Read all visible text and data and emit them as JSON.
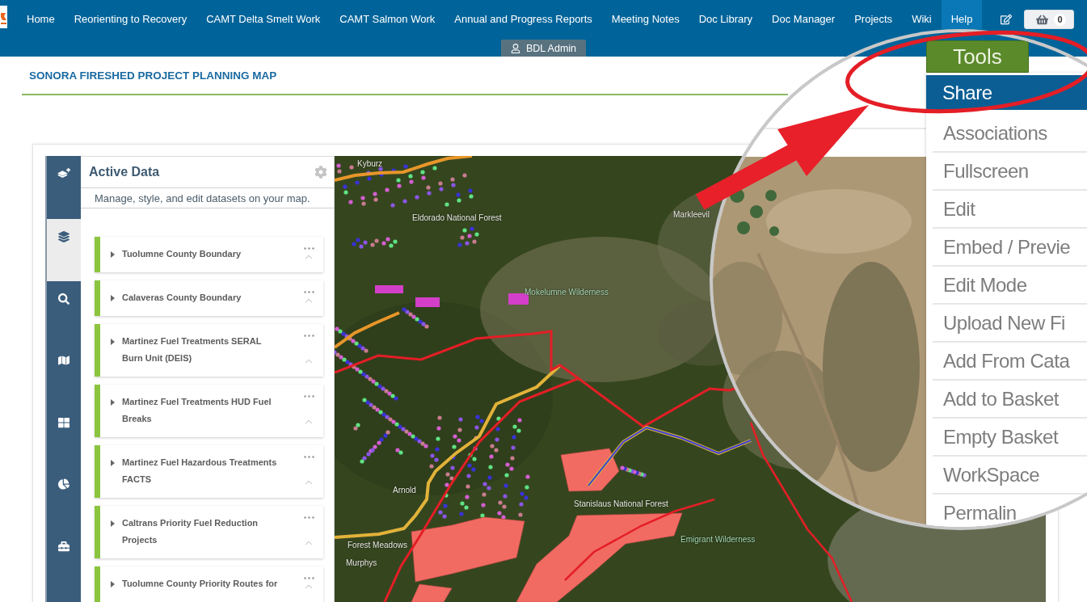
{
  "nav": {
    "items": [
      {
        "label": "Home",
        "selected": false
      },
      {
        "label": "Reorienting to Recovery",
        "selected": false
      },
      {
        "label": "CAMT Delta Smelt Work",
        "selected": false
      },
      {
        "label": "CAMT Salmon Work",
        "selected": false
      },
      {
        "label": "Annual and Progress Reports",
        "selected": false
      },
      {
        "label": "Meeting Notes",
        "selected": false
      },
      {
        "label": "Doc Library",
        "selected": false
      },
      {
        "label": "Doc Manager",
        "selected": false
      },
      {
        "label": "Projects",
        "selected": false
      },
      {
        "label": "Wiki",
        "selected": false
      },
      {
        "label": "Help",
        "selected": true
      }
    ],
    "basket": {
      "count": "0"
    }
  },
  "user_tab": {
    "label": "BDL Admin"
  },
  "page_title": "SONORA FIRESHED PROJECT PLANNING MAP",
  "rail": {
    "items": [
      {
        "selected": false
      },
      {
        "selected": true
      },
      {
        "selected": false
      },
      {
        "selected": false
      },
      {
        "selected": false
      },
      {
        "selected": false
      },
      {
        "selected": false
      }
    ]
  },
  "active_data": {
    "title": "Active Data",
    "subtitle": "Manage, style, and edit datasets on your map.",
    "layers": [
      {
        "name": "Tuolumne County Boundary"
      },
      {
        "name": "Calaveras County Boundary"
      },
      {
        "name": "Martinez Fuel Treatments SERAL Burn Unit (DEIS)"
      },
      {
        "name": "Martinez Fuel Treatments HUD Fuel Breaks"
      },
      {
        "name": "Martinez Fuel Hazardous Treatments FACTS"
      },
      {
        "name": "Caltrans Priority Fuel Reduction Projects"
      },
      {
        "name": "Tuolumne County Priority Routes for"
      }
    ]
  },
  "map": {
    "labels": [
      {
        "text": "Kyburz",
        "kind": "place"
      },
      {
        "text": "Eldorado National Forest",
        "kind": "place"
      },
      {
        "text": "Mokelumne Wilderness",
        "kind": "wilderness"
      },
      {
        "text": "Markleevil",
        "kind": "place"
      },
      {
        "text": "Arnold",
        "kind": "place"
      },
      {
        "text": "Forest Meadows",
        "kind": "place"
      },
      {
        "text": "Murphys",
        "kind": "place"
      },
      {
        "text": "Stanislaus National Forest",
        "kind": "place"
      },
      {
        "text": "Emigrant Wilderness",
        "kind": "wilderness"
      }
    ]
  },
  "magnifier": {
    "tools_button": "Tools",
    "menu": [
      {
        "label": "Share",
        "selected": true
      },
      {
        "label": "Associations",
        "selected": false
      },
      {
        "label": "Fullscreen",
        "selected": false
      },
      {
        "label": "Edit",
        "selected": false
      },
      {
        "label": "Embed / Previe",
        "selected": false
      },
      {
        "label": "Edit Mode",
        "selected": false
      },
      {
        "label": "Upload New Fi",
        "selected": false
      },
      {
        "label": "Add From Cata",
        "selected": false
      },
      {
        "label": "Add to Basket",
        "selected": false
      },
      {
        "label": "Empty Basket",
        "selected": false
      },
      {
        "label": "WorkSpace",
        "selected": false
      },
      {
        "label": "Permalin",
        "selected": false
      }
    ]
  }
}
